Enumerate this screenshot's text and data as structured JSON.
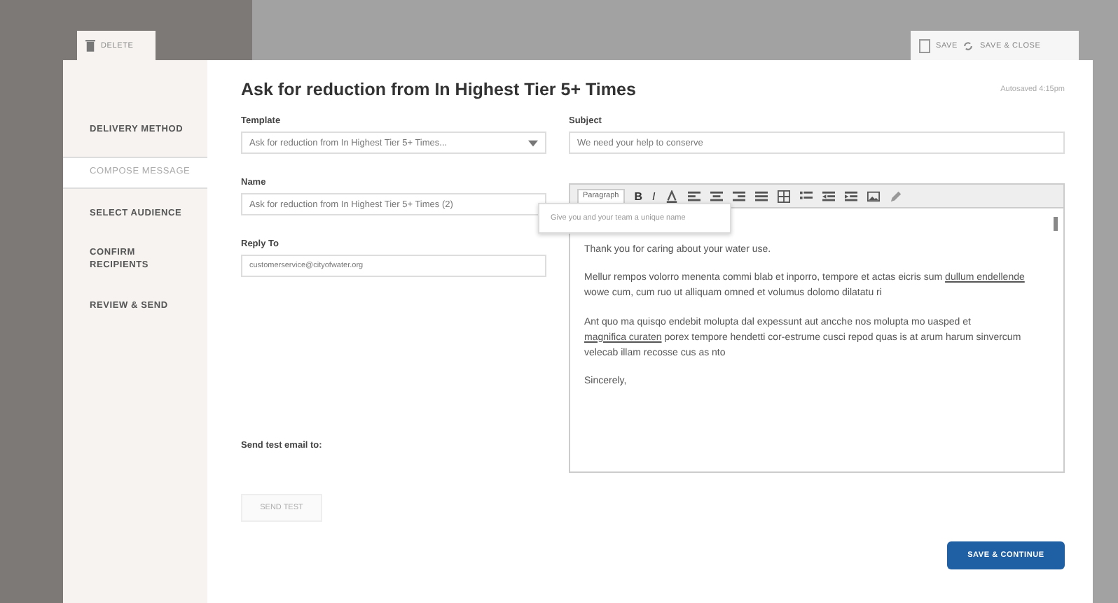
{
  "top_tabs": {
    "delete": "DELETE",
    "save": "SAVE",
    "save_close": "SAVE & CLOSE"
  },
  "sidebar": {
    "items": [
      {
        "label": "DELIVERY METHOD",
        "selected": false
      },
      {
        "label": "COMPOSE MESSAGE",
        "selected": true
      },
      {
        "label": "SELECT AUDIENCE",
        "selected": false
      },
      {
        "label": "CONFIRM RECIPIENTS",
        "selected": false
      },
      {
        "label": "REVIEW & SEND",
        "selected": false
      }
    ]
  },
  "title": "Ask for reduction from In Highest Tier 5+ Times",
  "status": "Autosaved 4:15pm",
  "template": {
    "label": "Template",
    "value": "Ask for reduction from In Highest Tier 5+ Times..."
  },
  "subject": {
    "label": "Subject",
    "value": "We need your help to conserve"
  },
  "name": {
    "label": "Name",
    "value": "Ask for reduction from In Highest Tier 5+ Times (2)"
  },
  "reply_to": {
    "label": "Reply To",
    "value": "customerservice@cityofwater.org"
  },
  "tooltip": "Give you and your team a unique name",
  "toolbar": {
    "format": "Paragraph",
    "buttons": [
      {
        "kind": "bold",
        "label": "B"
      },
      {
        "kind": "italic",
        "label": "I"
      },
      {
        "kind": "color"
      },
      {
        "kind": "align-left"
      },
      {
        "kind": "align-center"
      },
      {
        "kind": "align-right"
      },
      {
        "kind": "justify"
      },
      {
        "kind": "table"
      },
      {
        "kind": "list"
      },
      {
        "kind": "outdent"
      },
      {
        "kind": "indent"
      },
      {
        "kind": "image"
      },
      {
        "kind": "pencil"
      }
    ]
  },
  "body": [
    [
      {
        "text": "Thank you for caring about your water use."
      }
    ],
    [
      {
        "text": "Mellur rempos volorro menenta commi blab et inporro, tempore et actas eicris sum "
      },
      {
        "text": "dullum endellende",
        "link": true
      },
      {
        "text": " wowe cum, cum ruo ut alliquam omned et volumus dolomo dilatatu ri"
      }
    ],
    [
      {
        "text": "Ant quo ma quisqo endebit molupta dal expessunt aut ancche nos molupta mo uasped et "
      },
      {
        "text": "magnifica curaten",
        "link": true
      },
      {
        "text": " porex tempore hendetti cor-estrume cusci repod quas is at arum harum sinvercum velecab illam recosse cus as nto"
      }
    ],
    [
      {
        "text": "Sincerely,"
      }
    ]
  ],
  "test_email": {
    "label": "Send test email to:",
    "button": "SEND TEST"
  },
  "continue_button": "SAVE & CONTINUE"
}
